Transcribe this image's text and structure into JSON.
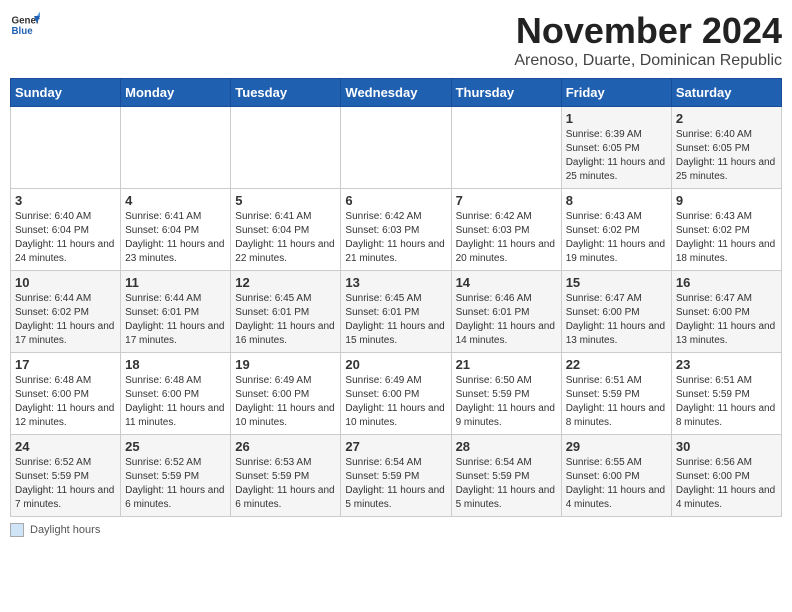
{
  "header": {
    "logo_general": "General",
    "logo_blue": "Blue",
    "month_title": "November 2024",
    "subtitle": "Arenoso, Duarte, Dominican Republic"
  },
  "days_of_week": [
    "Sunday",
    "Monday",
    "Tuesday",
    "Wednesday",
    "Thursday",
    "Friday",
    "Saturday"
  ],
  "weeks": [
    [
      {
        "day": "",
        "info": ""
      },
      {
        "day": "",
        "info": ""
      },
      {
        "day": "",
        "info": ""
      },
      {
        "day": "",
        "info": ""
      },
      {
        "day": "",
        "info": ""
      },
      {
        "day": "1",
        "info": "Sunrise: 6:39 AM\nSunset: 6:05 PM\nDaylight: 11 hours and 25 minutes."
      },
      {
        "day": "2",
        "info": "Sunrise: 6:40 AM\nSunset: 6:05 PM\nDaylight: 11 hours and 25 minutes."
      }
    ],
    [
      {
        "day": "3",
        "info": "Sunrise: 6:40 AM\nSunset: 6:04 PM\nDaylight: 11 hours and 24 minutes."
      },
      {
        "day": "4",
        "info": "Sunrise: 6:41 AM\nSunset: 6:04 PM\nDaylight: 11 hours and 23 minutes."
      },
      {
        "day": "5",
        "info": "Sunrise: 6:41 AM\nSunset: 6:04 PM\nDaylight: 11 hours and 22 minutes."
      },
      {
        "day": "6",
        "info": "Sunrise: 6:42 AM\nSunset: 6:03 PM\nDaylight: 11 hours and 21 minutes."
      },
      {
        "day": "7",
        "info": "Sunrise: 6:42 AM\nSunset: 6:03 PM\nDaylight: 11 hours and 20 minutes."
      },
      {
        "day": "8",
        "info": "Sunrise: 6:43 AM\nSunset: 6:02 PM\nDaylight: 11 hours and 19 minutes."
      },
      {
        "day": "9",
        "info": "Sunrise: 6:43 AM\nSunset: 6:02 PM\nDaylight: 11 hours and 18 minutes."
      }
    ],
    [
      {
        "day": "10",
        "info": "Sunrise: 6:44 AM\nSunset: 6:02 PM\nDaylight: 11 hours and 17 minutes."
      },
      {
        "day": "11",
        "info": "Sunrise: 6:44 AM\nSunset: 6:01 PM\nDaylight: 11 hours and 17 minutes."
      },
      {
        "day": "12",
        "info": "Sunrise: 6:45 AM\nSunset: 6:01 PM\nDaylight: 11 hours and 16 minutes."
      },
      {
        "day": "13",
        "info": "Sunrise: 6:45 AM\nSunset: 6:01 PM\nDaylight: 11 hours and 15 minutes."
      },
      {
        "day": "14",
        "info": "Sunrise: 6:46 AM\nSunset: 6:01 PM\nDaylight: 11 hours and 14 minutes."
      },
      {
        "day": "15",
        "info": "Sunrise: 6:47 AM\nSunset: 6:00 PM\nDaylight: 11 hours and 13 minutes."
      },
      {
        "day": "16",
        "info": "Sunrise: 6:47 AM\nSunset: 6:00 PM\nDaylight: 11 hours and 13 minutes."
      }
    ],
    [
      {
        "day": "17",
        "info": "Sunrise: 6:48 AM\nSunset: 6:00 PM\nDaylight: 11 hours and 12 minutes."
      },
      {
        "day": "18",
        "info": "Sunrise: 6:48 AM\nSunset: 6:00 PM\nDaylight: 11 hours and 11 minutes."
      },
      {
        "day": "19",
        "info": "Sunrise: 6:49 AM\nSunset: 6:00 PM\nDaylight: 11 hours and 10 minutes."
      },
      {
        "day": "20",
        "info": "Sunrise: 6:49 AM\nSunset: 6:00 PM\nDaylight: 11 hours and 10 minutes."
      },
      {
        "day": "21",
        "info": "Sunrise: 6:50 AM\nSunset: 5:59 PM\nDaylight: 11 hours and 9 minutes."
      },
      {
        "day": "22",
        "info": "Sunrise: 6:51 AM\nSunset: 5:59 PM\nDaylight: 11 hours and 8 minutes."
      },
      {
        "day": "23",
        "info": "Sunrise: 6:51 AM\nSunset: 5:59 PM\nDaylight: 11 hours and 8 minutes."
      }
    ],
    [
      {
        "day": "24",
        "info": "Sunrise: 6:52 AM\nSunset: 5:59 PM\nDaylight: 11 hours and 7 minutes."
      },
      {
        "day": "25",
        "info": "Sunrise: 6:52 AM\nSunset: 5:59 PM\nDaylight: 11 hours and 6 minutes."
      },
      {
        "day": "26",
        "info": "Sunrise: 6:53 AM\nSunset: 5:59 PM\nDaylight: 11 hours and 6 minutes."
      },
      {
        "day": "27",
        "info": "Sunrise: 6:54 AM\nSunset: 5:59 PM\nDaylight: 11 hours and 5 minutes."
      },
      {
        "day": "28",
        "info": "Sunrise: 6:54 AM\nSunset: 5:59 PM\nDaylight: 11 hours and 5 minutes."
      },
      {
        "day": "29",
        "info": "Sunrise: 6:55 AM\nSunset: 6:00 PM\nDaylight: 11 hours and 4 minutes."
      },
      {
        "day": "30",
        "info": "Sunrise: 6:56 AM\nSunset: 6:00 PM\nDaylight: 11 hours and 4 minutes."
      }
    ]
  ],
  "legend": {
    "box_label": "Daylight hours"
  }
}
